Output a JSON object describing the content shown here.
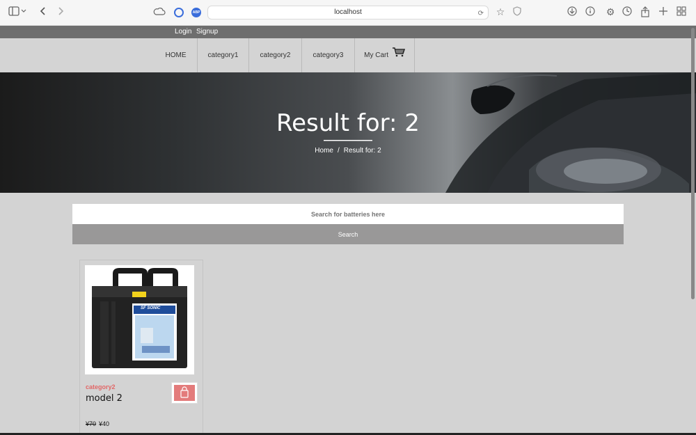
{
  "browser": {
    "url": "localhost"
  },
  "topbar": {
    "login": "Login",
    "signup": "Signup"
  },
  "nav": {
    "items": [
      "HOME",
      "category1",
      "category2",
      "category3"
    ],
    "cart": "My Cart"
  },
  "hero": {
    "title": "Result for: 2",
    "breadcrumb_home": "Home",
    "breadcrumb_sep": "/",
    "breadcrumb_current": "Result for: 2"
  },
  "search": {
    "placeholder": "Search for batteries here",
    "button": "Search"
  },
  "products": [
    {
      "category": "category2",
      "name": "model 2",
      "old_price": "¥70",
      "price": "¥40",
      "image_brand_text": "SF SONIC"
    }
  ],
  "colors": {
    "accent": "#e26767",
    "topbar": "#6e6e6e"
  }
}
